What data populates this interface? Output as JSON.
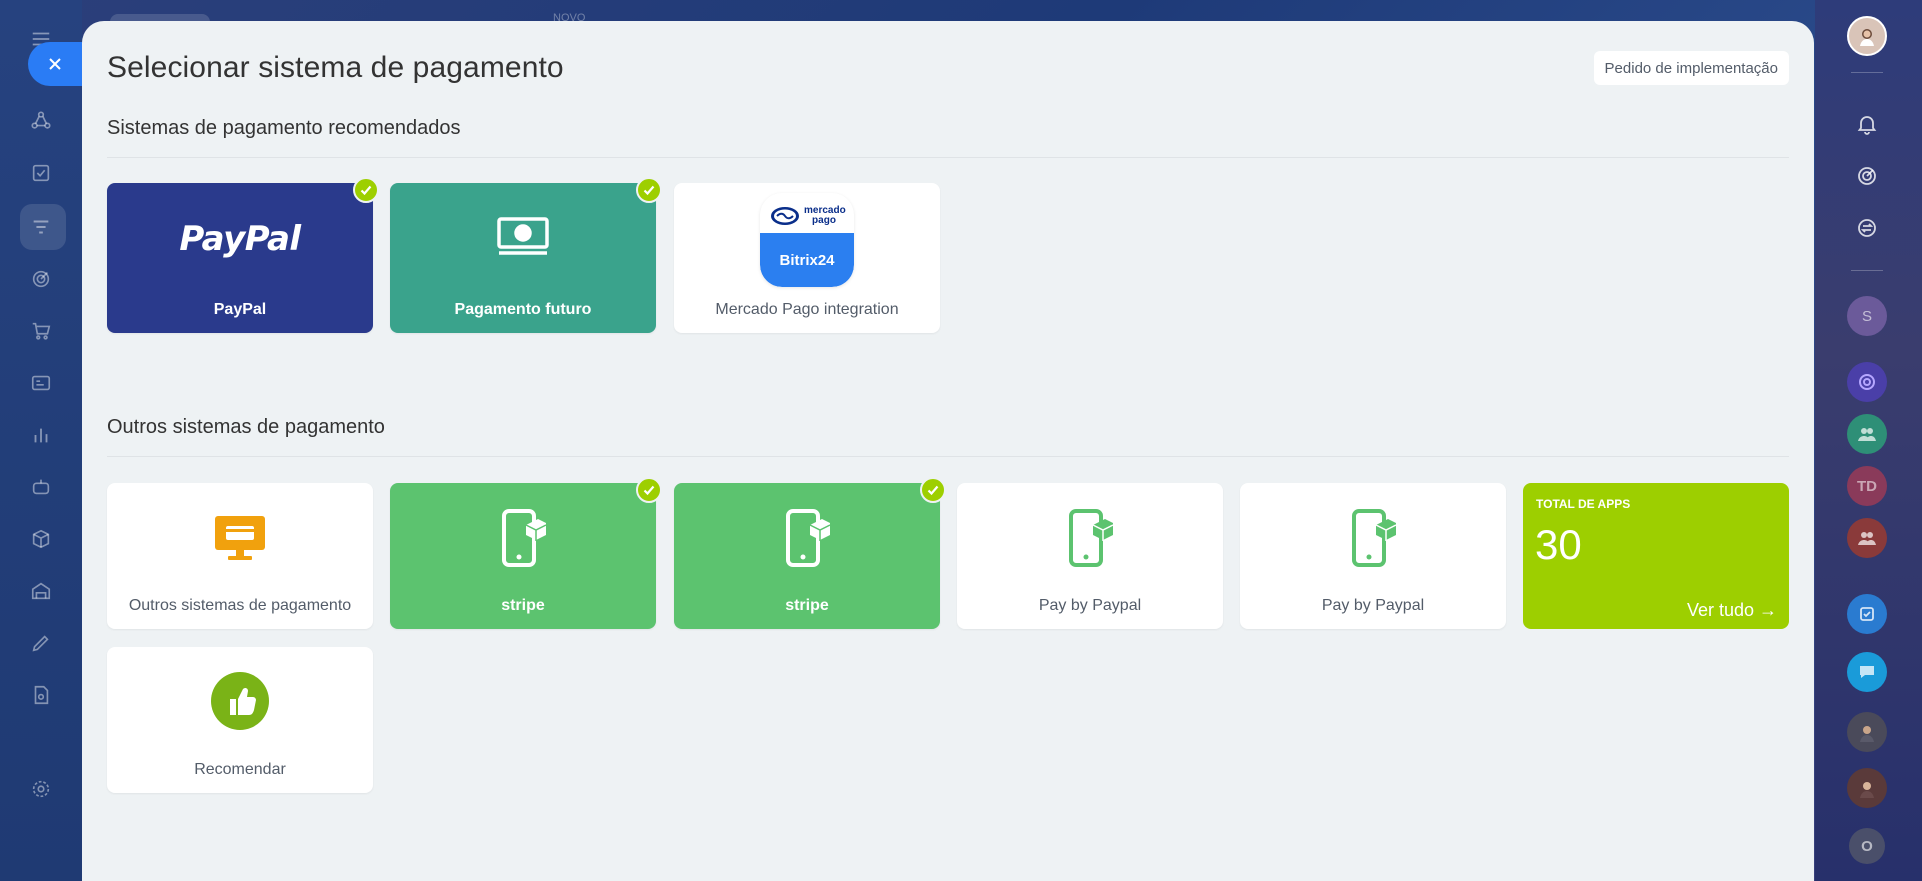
{
  "background": {
    "top_hint": "NOVO"
  },
  "page": {
    "title": "Selecionar sistema de pagamento",
    "implementation_request": "Pedido de implementação"
  },
  "recommended": {
    "title": "Sistemas de pagamento recomendados",
    "items": [
      {
        "label": "PayPal",
        "logo_text": "PayPal",
        "installed": true,
        "color": "#2a3a8c"
      },
      {
        "label": "Pagamento futuro",
        "installed": true,
        "color": "#3aa38c"
      },
      {
        "label": "Mercado Pago integration",
        "logo_top": "mercado pago",
        "logo_bottom": "Bitrix24",
        "installed": false
      }
    ]
  },
  "others": {
    "title": "Outros sistemas de pagamento",
    "items": [
      {
        "label": "Outros sistemas de pagamento",
        "installed": false
      },
      {
        "label": "stripe",
        "installed": true,
        "color": "#5cc36f"
      },
      {
        "label": "stripe",
        "installed": true,
        "color": "#5cc36f"
      },
      {
        "label": "Pay by Paypal",
        "installed": false
      },
      {
        "label": "Pay by Paypal",
        "installed": false
      }
    ],
    "apps": {
      "label": "TOTAL DE APPS",
      "count": "30",
      "link": "Ver tudo →",
      "color": "#9dcf00"
    },
    "recommend": {
      "label": "Recomendar"
    }
  },
  "right_rail": {
    "td_initials": "TD",
    "s_initial": "S",
    "o_initial": "O"
  },
  "colors": {
    "check": "#9dcf00",
    "close": "#2a7cf5",
    "phone_green": "#5cc36f",
    "orange": "#f1a10d"
  }
}
